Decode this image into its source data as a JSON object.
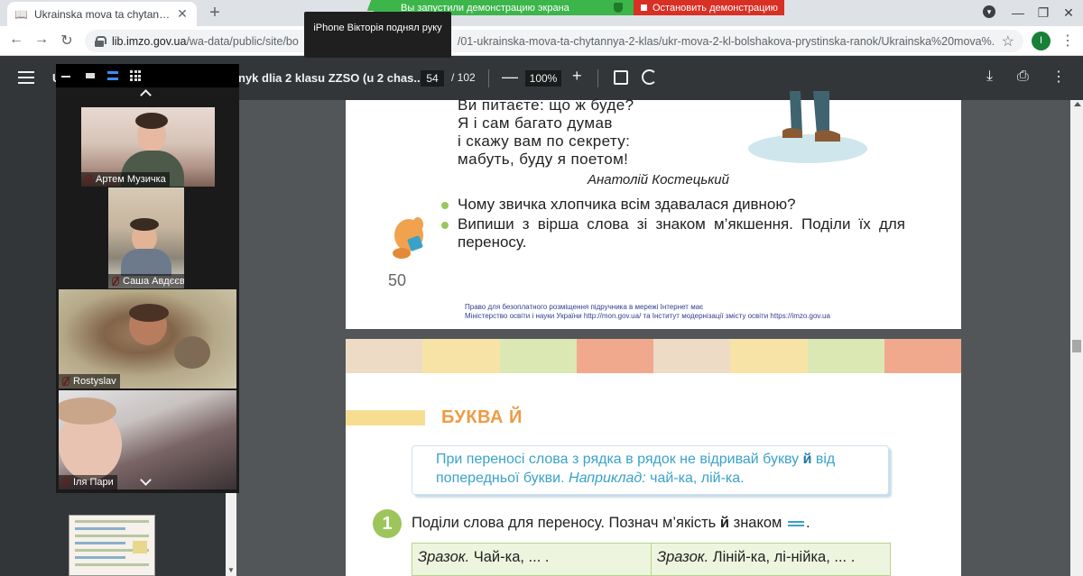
{
  "browser": {
    "tab_icon": "book-icon",
    "tab_title": "Ukrainska mova ta chytannia_pid...",
    "tab_close": "✕",
    "new_tab": "+",
    "url_host": "lib.imzo.gov.ua",
    "url_path": "/wa-data/public/site/bo",
    "url_path_end": "/01-ukrainska-mova-ta-chytannya-2-klas/ukr-mova-2-kl-bolshakova-prystinska-ranok/Ukrainska%20mova%...",
    "avatar_letter": "I"
  },
  "screen_share": {
    "banner": "Вы запустили демонстрацию экрана",
    "stop": "Остановить демонстрацию",
    "raised_hand_tip": "iPhone Вікторія поднял руку"
  },
  "pdf_toolbar": {
    "title_left": "U",
    "title_right": "nyk dlia 2 klasu ZZSO (u 2 chas...",
    "page_current": "54",
    "page_total": "/ 102",
    "zoom": "100%"
  },
  "page50": {
    "poem_lines": [
      "Ви питаєте: що ж буде?",
      "Я і сам багато думав",
      "і скажу вам по секрету:",
      "мабуть, буду я поетом!"
    ],
    "author": "Анатолій Костецький",
    "questions": [
      "Чому звичка хлопчика всім здавалася дивною?",
      "Випиши з вірша слова зі знаком м’якшення. Поділи їх для переносу."
    ],
    "page_number": "50",
    "copyright_line1": "Право для безоплатного розміщення підручника в мережі Інтернет має",
    "copyright_line2": "Міністерство освіти і науки України http://mon.gov.ua/ та Інститут модернізації змісту освіти https://imzo.gov.ua"
  },
  "page51": {
    "stripe_colors": [
      "#eddbc6",
      "#f7e3a6",
      "#dbe8b4",
      "#f1a98d",
      "#eddbc6",
      "#f7e3a6",
      "#dbe8b4",
      "#f1a98d"
    ],
    "section_title": "БУКВА Й",
    "rule_part1": "При переносі слова з рядка в рядок не відривай букву",
    "rule_letter": "й",
    "rule_part2": "від попередньої букви.",
    "rule_example_label": "Наприклад:",
    "rule_example": "чай-ка, лій-ка.",
    "task_number": "1",
    "task_text_part1": "Поділи слова для переносу. Познач м’якість",
    "task_letter": "й",
    "task_text_part2": "знаком",
    "task_text_end": ".",
    "table_left_label": "Зразок.",
    "table_left": "Чай-ка, ... .",
    "table_right_label": "Зразок.",
    "table_right": "Ліній-ка, лі-нійка, ... ."
  },
  "video_panel": {
    "participants": [
      {
        "name": "Артем Музичка"
      },
      {
        "name": "Саша Авдєєв"
      },
      {
        "name": "Rostyslav"
      },
      {
        "name": "Іля Пари"
      }
    ]
  }
}
